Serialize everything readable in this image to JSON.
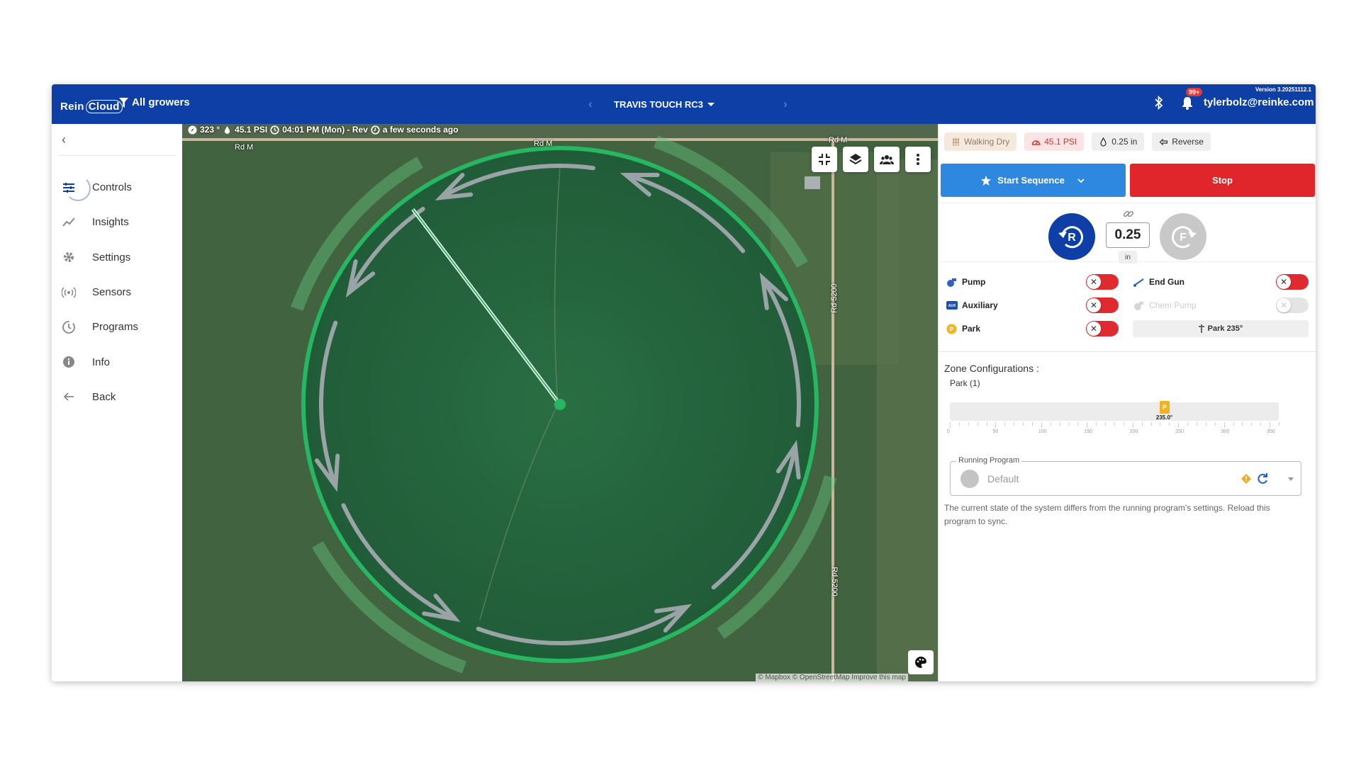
{
  "header": {
    "logo_main": "Rein",
    "logo_cloud": "Cloud",
    "growers_label": "All growers",
    "pivot_name": "TRAVIS TOUCH RC3",
    "prev_icon": "chevron-left",
    "next_icon": "chevron-right",
    "notification_count": "99+",
    "user_email": "tylerbolz@reinke.com",
    "version": "Version 3.20251112.1",
    "brand_color": "#0d3fa7"
  },
  "sidebar": {
    "collapse_icon": "chevron-left",
    "items": [
      {
        "label": "Controls",
        "icon": "sliders-icon"
      },
      {
        "label": "Insights",
        "icon": "chart-line-icon"
      },
      {
        "label": "Settings",
        "icon": "gear-icon"
      },
      {
        "label": "Sensors",
        "icon": "signal-icon"
      },
      {
        "label": "Programs",
        "icon": "program-icon"
      },
      {
        "label": "Info",
        "icon": "info-icon"
      },
      {
        "label": "Back",
        "icon": "arrow-left-icon"
      }
    ]
  },
  "map": {
    "status": {
      "angle": "323 °",
      "pressure": "45.1 PSI",
      "time": "04:01 PM (Mon) - Rev",
      "updated": "a few seconds ago"
    },
    "road_labels": [
      "Rd M",
      "Rd M",
      "Rd M",
      "Rd 5200",
      "Rd 5200"
    ],
    "attribution": "© Mapbox © OpenStreetMap Improve this map",
    "controls": [
      "fullscreen-exit-icon",
      "layers-icon",
      "group-icon",
      "more-vert-icon"
    ],
    "pivot_angle_deg": 323,
    "circle_color": "#27b661"
  },
  "panel": {
    "chips": {
      "walking": "Walking Dry",
      "pressure": "45.1 PSI",
      "depth": "0.25 in",
      "direction": "Reverse"
    },
    "start_sequence": "Start Sequence",
    "stop": "Stop",
    "depth_value": "0.25",
    "depth_unit": "in",
    "reverse_letter": "R",
    "forward_letter": "F",
    "toggles": {
      "pump": "Pump",
      "end_gun": "End Gun",
      "auxiliary": "Auxiliary",
      "chem_pump": "Chem Pump",
      "park": "Park",
      "park_value": "Park 235°"
    },
    "zone_title": "Zone Configurations :",
    "zone_sub": "Park (1)",
    "slider": {
      "marker": "P",
      "value_label": "235.0°",
      "value": 235,
      "max": 360,
      "ticks": [
        "0",
        "50",
        "100",
        "150",
        "200",
        "250",
        "300",
        "350"
      ]
    },
    "running_program": {
      "label": "Running Program",
      "value": "Default"
    },
    "message": "The current state of the system differs from the running program's settings. Reload this program to sync.",
    "colors": {
      "start": "#2f88e0",
      "stop": "#e0262b",
      "warn": "#f2a91c"
    }
  }
}
